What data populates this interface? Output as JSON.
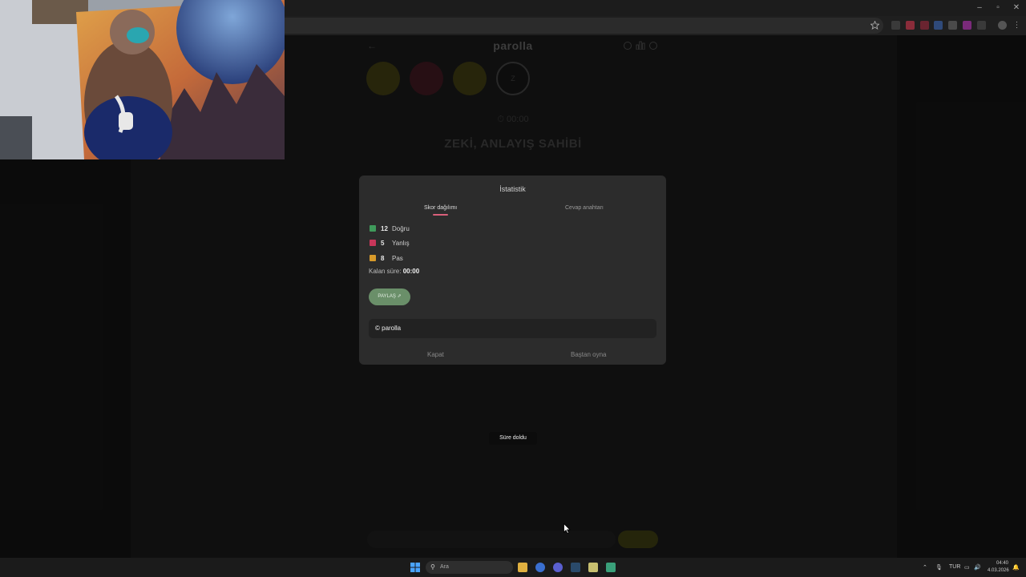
{
  "browser": {
    "window_controls": {
      "minimize": "–",
      "restore": "▫",
      "close": "✕"
    }
  },
  "app": {
    "brand": "parolla",
    "back_icon": "arrow-left-icon",
    "header_icons": [
      "info-icon",
      "chart-icon",
      "settings-icon"
    ],
    "timer": "00:00",
    "headline": "ZEKİ, ANLAYIŞ SAHİBİ",
    "circle_colors": [
      "#3d3a12",
      "#3d1720",
      "#3d3a12"
    ],
    "circle_last_label": "Z"
  },
  "modal": {
    "title": "İstatistik",
    "tabs": [
      {
        "label": "Skor dağılımı",
        "active": true
      },
      {
        "label": "Cevap anahtarı",
        "active": false
      }
    ],
    "stats": [
      {
        "count": "12",
        "label": "Doğru",
        "color": "#3f9a5b"
      },
      {
        "count": "5",
        "label": "Yanlış",
        "color": "#c8365a"
      },
      {
        "count": "8",
        "label": "Pas",
        "color": "#d79a2a"
      }
    ],
    "remaining_label": "Kalan süre:",
    "remaining_value": "00:00",
    "share_button": "PAYLAŞ ⇗",
    "brand_box": "© parolla",
    "close_button": "Kapat",
    "restart_button": "Baştan oyna"
  },
  "toast": "Süre doldu",
  "taskbar": {
    "search_placeholder": "Ara",
    "language": "TUR",
    "time": "04:40",
    "date": "4.03.2026"
  },
  "colors": {
    "accent_pink": "#d9607a",
    "share_green": "#6a8f69",
    "modal_bg": "#2c2c2c"
  }
}
